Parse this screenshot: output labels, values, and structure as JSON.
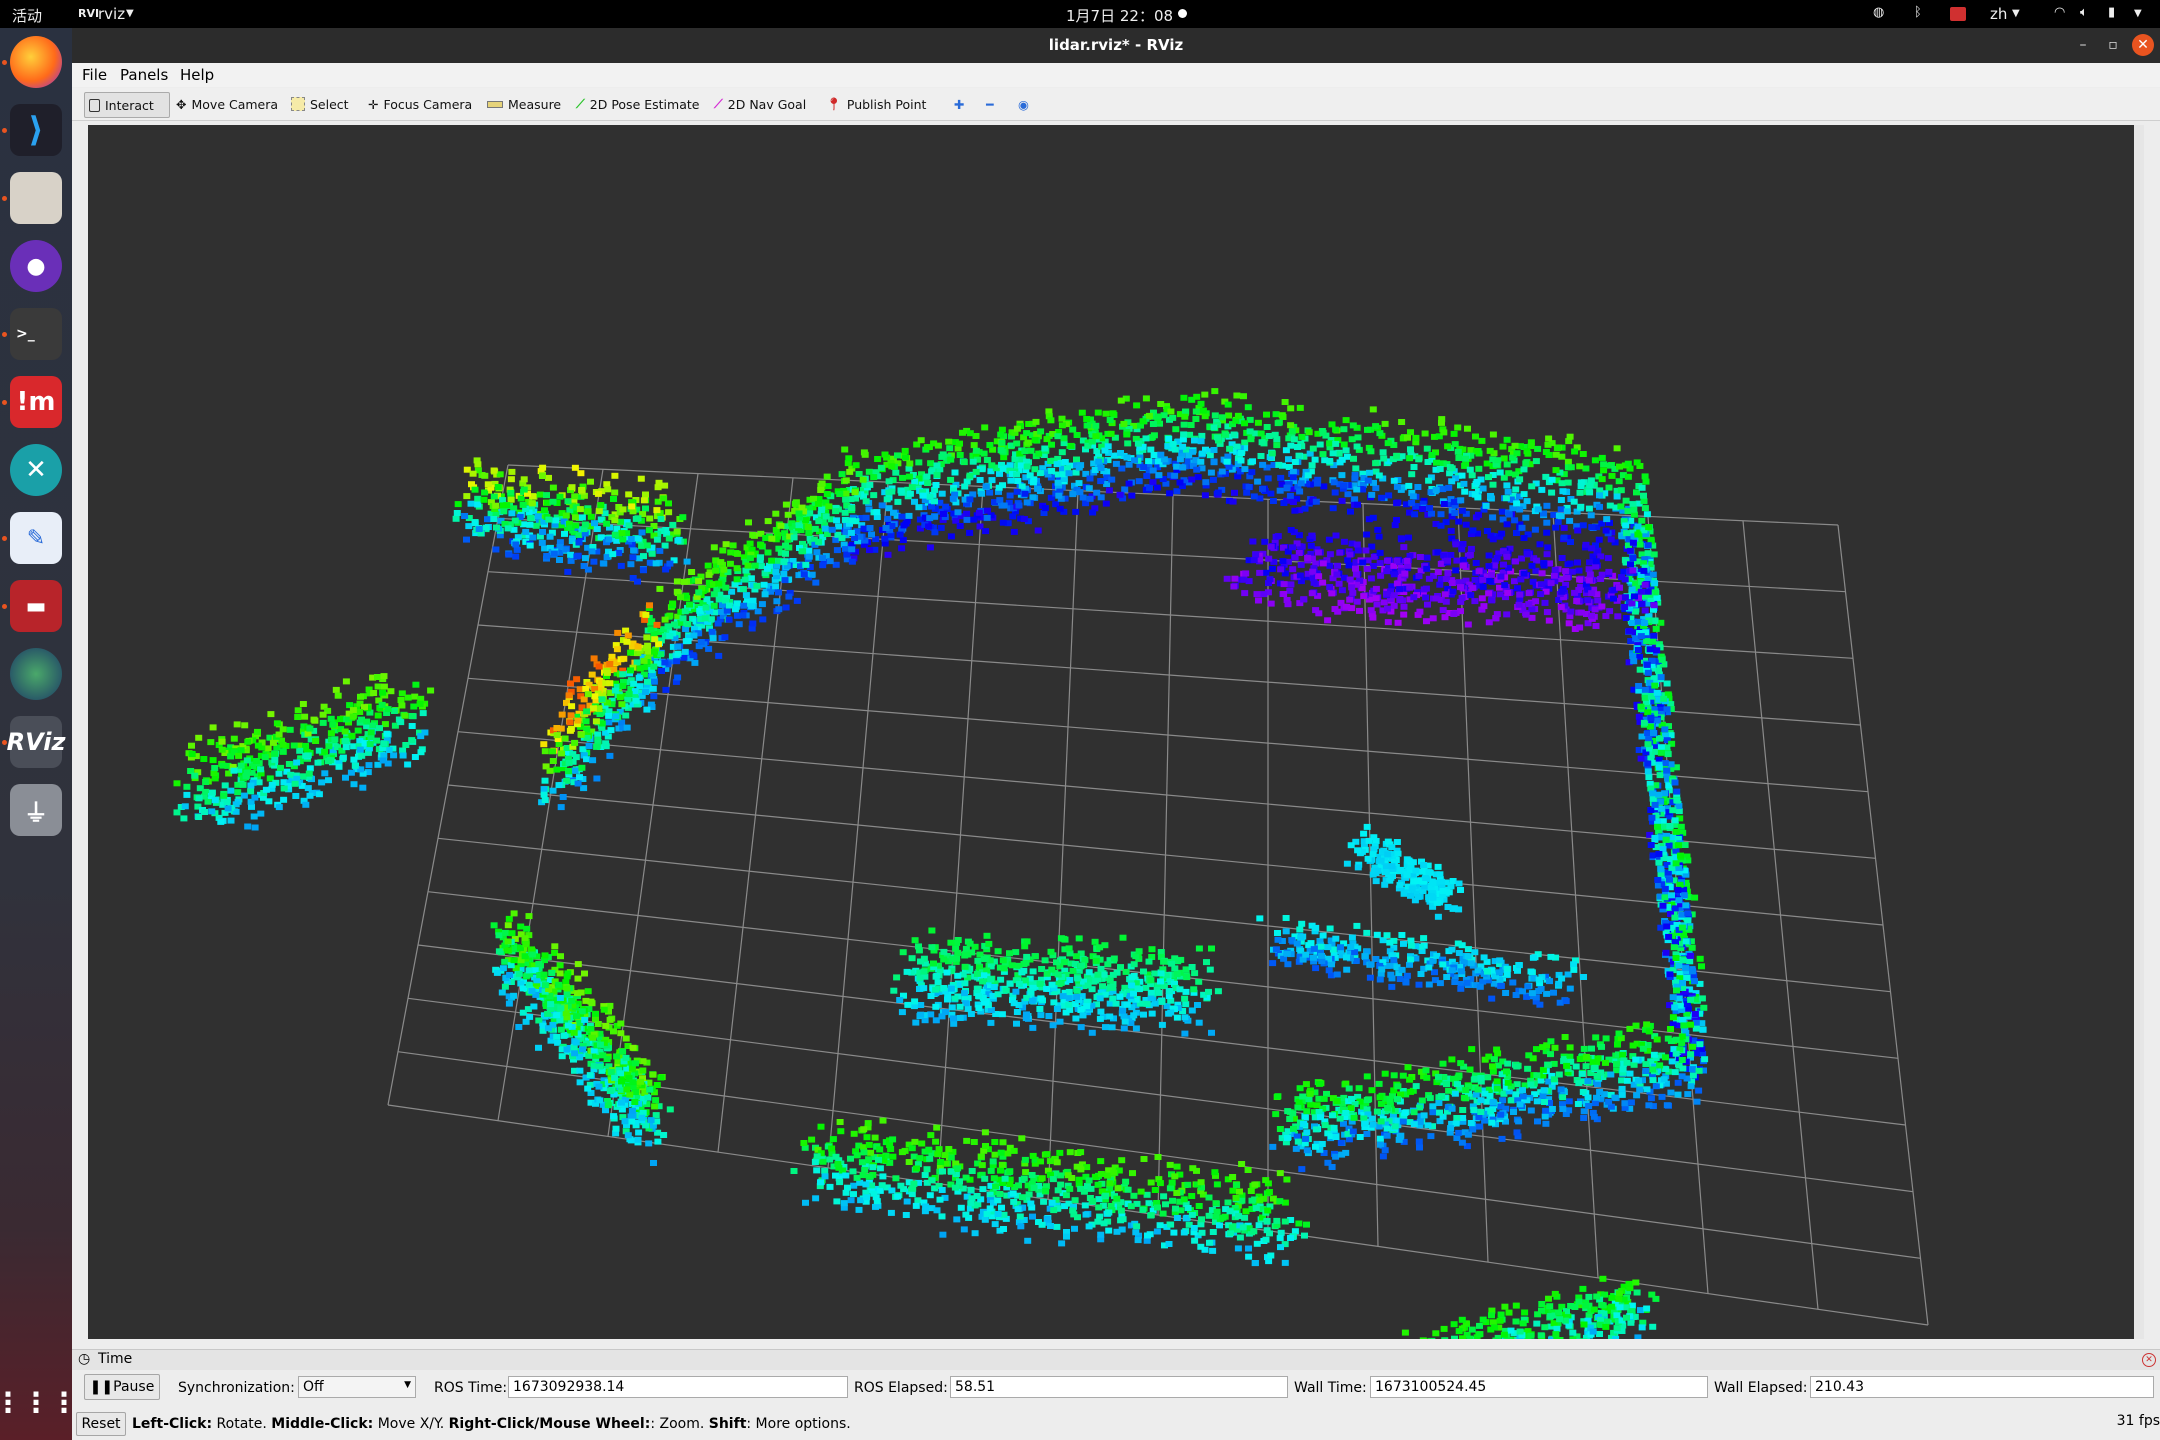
{
  "topbar": {
    "activities": "活动",
    "app_menu": "rviz",
    "clock": "1月7日  22：08",
    "input_method": "zh"
  },
  "dock": {
    "items": [
      "firefox-icon",
      "vscode-icon",
      "files-icon",
      "github-icon",
      "terminal-icon",
      "mindmaster-icon",
      "crossover-icon",
      "text-editor-icon",
      "presentation-icon",
      "globe-icon",
      "rviz-icon",
      "usb-icon"
    ],
    "apps_grid": "show-applications-icon"
  },
  "window": {
    "title": "lidar.rviz* - RViz"
  },
  "menubar": {
    "file": "File",
    "panels": "Panels",
    "help": "Help"
  },
  "toolbar": {
    "interact": "Interact",
    "move_camera": "Move Camera",
    "select": "Select",
    "focus_camera": "Focus Camera",
    "measure": "Measure",
    "pose_estimate": "2D Pose Estimate",
    "nav_goal": "2D Nav Goal",
    "publish_point": "Publish Point"
  },
  "time_panel": {
    "title": "Time",
    "pause": "Pause",
    "sync_label": "Synchronization:",
    "sync_value": "Off",
    "ros_time_label": "ROS Time:",
    "ros_time": "1673092938.14",
    "ros_elapsed_label": "ROS Elapsed:",
    "ros_elapsed": "58.51",
    "wall_time_label": "Wall Time:",
    "wall_time": "1673100524.45",
    "wall_elapsed_label": "Wall Elapsed:",
    "wall_elapsed": "210.43"
  },
  "statusbar": {
    "reset": "Reset",
    "help_left_b": "Left-Click:",
    "help_left": " Rotate. ",
    "help_middle_b": "Middle-Click:",
    "help_middle": " Move X/Y. ",
    "help_right_b": "Right-Click/Mouse Wheel:",
    "help_right": ": Zoom. ",
    "help_shift_b": "Shift",
    "help_shift": ": More options.",
    "fps": "31 fps"
  },
  "colors": {
    "accent_active": "#e95420",
    "viewport_bg": "#303030",
    "grid": "#8a8a8a"
  }
}
